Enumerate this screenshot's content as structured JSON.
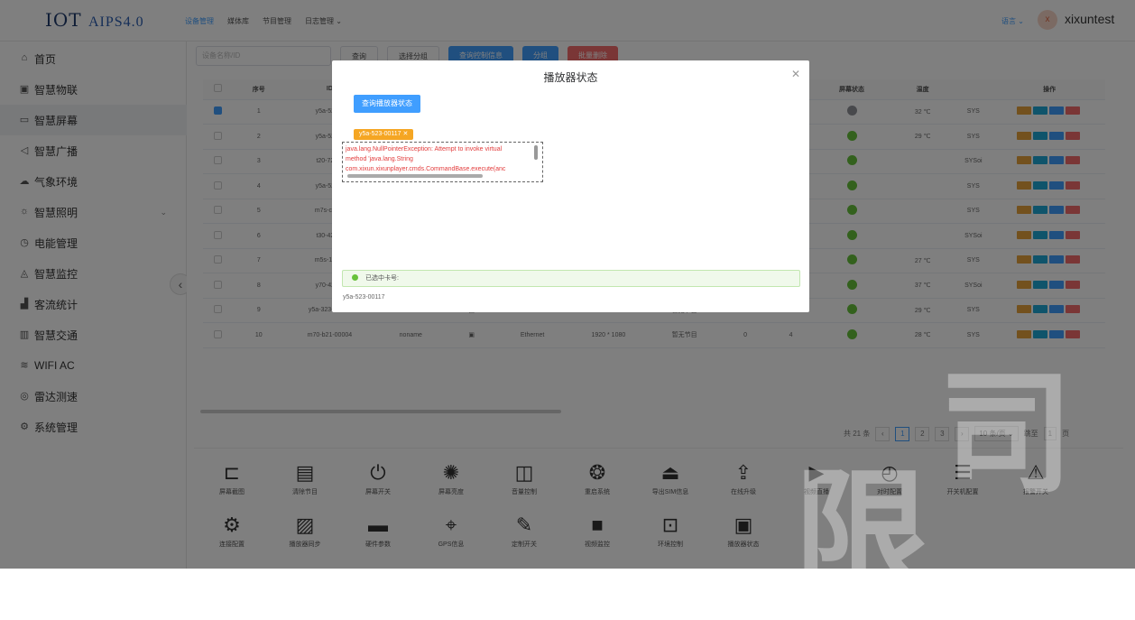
{
  "brand": {
    "name": "IOT",
    "version": "AIPS4.0"
  },
  "topnav": [
    "设备管理",
    "媒体库",
    "节目管理",
    "日志管理 ⌄"
  ],
  "lang": "语言 ⌄",
  "user": {
    "avatar": "x",
    "name": "xixuntest"
  },
  "sidebar": {
    "items": [
      {
        "label": "首页",
        "icon": "home-icon"
      },
      {
        "label": "智慧物联",
        "icon": "iot-icon"
      },
      {
        "label": "智慧屏幕",
        "icon": "screen-icon"
      },
      {
        "label": "智慧广播",
        "icon": "speaker-icon"
      },
      {
        "label": "气象环境",
        "icon": "cloud-icon"
      },
      {
        "label": "智慧照明",
        "icon": "light-icon"
      },
      {
        "label": "电能管理",
        "icon": "power-icon"
      },
      {
        "label": "智慧监控",
        "icon": "camera-icon"
      },
      {
        "label": "客流统计",
        "icon": "stats-icon"
      },
      {
        "label": "智慧交通",
        "icon": "traffic-icon"
      },
      {
        "label": "WIFI AC",
        "icon": "wifi-icon"
      },
      {
        "label": "雷达测速",
        "icon": "radar-icon"
      },
      {
        "label": "系统管理",
        "icon": "gear-icon"
      }
    ]
  },
  "toolbar": {
    "search_placeholder": "设备名称/ID",
    "query": "查询",
    "group_select": "选择分组",
    "query_controller": "查询控制信息",
    "group": "分组",
    "batch_delete": "批量删除"
  },
  "table": {
    "headers": [
      "序号",
      "ID",
      "屏幕状态",
      "温度",
      "操作"
    ],
    "rows": [
      {
        "no": "1",
        "id": "y5a-523-0",
        "name": "",
        "net": "",
        "res": "",
        "prog": "",
        "bright": "",
        "vol": "",
        "on": false,
        "temp": "32 ℃",
        "sys": "SYS"
      },
      {
        "no": "2",
        "id": "y5a-523-0",
        "name": "",
        "net": "",
        "res": "",
        "prog": "",
        "bright": "",
        "vol": "",
        "on": true,
        "temp": "29 ℃",
        "sys": "SYS"
      },
      {
        "no": "3",
        "id": "t20-721-2",
        "name": "",
        "net": "",
        "res": "",
        "prog": "",
        "bright": "",
        "vol": "",
        "on": true,
        "temp": "",
        "sys": "SYSoi"
      },
      {
        "no": "4",
        "id": "y5a-523-0",
        "name": "",
        "net": "",
        "res": "",
        "prog": "",
        "bright": "",
        "vol": "",
        "on": true,
        "temp": "",
        "sys": "SYS"
      },
      {
        "no": "5",
        "id": "m7s-c22-0",
        "name": "",
        "net": "",
        "res": "",
        "prog": "",
        "bright": "",
        "vol": "",
        "on": true,
        "temp": "",
        "sys": "SYS"
      },
      {
        "no": "6",
        "id": "t30-423-0",
        "name": "",
        "net": "",
        "res": "",
        "prog": "",
        "bright": "",
        "vol": "",
        "on": true,
        "temp": "",
        "sys": "SYSoi"
      },
      {
        "no": "7",
        "id": "m5s-123-0",
        "name": "",
        "net": "",
        "res": "",
        "prog": "",
        "bright": "",
        "vol": "",
        "on": true,
        "temp": "27 ℃",
        "sys": "SYS"
      },
      {
        "no": "8",
        "id": "y70-421-0",
        "name": "",
        "net": "",
        "res": "",
        "prog": "",
        "bright": "",
        "vol": "",
        "on": true,
        "temp": "37 ℃",
        "sys": "SYSoi"
      },
      {
        "no": "9",
        "id": "y5a-323-00013",
        "name": "noname",
        "net": "Ethernet",
        "res": "1280 * 720",
        "prog": "暂无节目",
        "bright": "100%",
        "vol": "12",
        "on": true,
        "temp": "29 ℃",
        "sys": "SYS"
      },
      {
        "no": "10",
        "id": "m70-b21-00004",
        "name": "noname",
        "net": "Ethernet",
        "res": "1920 * 1080",
        "prog": "暂无节目",
        "bright": "0",
        "vol": "4",
        "on": true,
        "temp": "28 ℃",
        "sys": "SYS"
      }
    ]
  },
  "pager": {
    "total": "共 21 条",
    "pages": [
      "1",
      "2",
      "3"
    ],
    "size": "10 条/页 ⌄",
    "goto": "跳至",
    "goto_val": "1",
    "page_suffix": "页"
  },
  "functions": [
    {
      "label": "屏幕截图",
      "glyph": "⊏"
    },
    {
      "label": "清除节目",
      "glyph": "▤"
    },
    {
      "label": "屏幕开关",
      "glyph": "⏻"
    },
    {
      "label": "屏幕亮度",
      "glyph": "✺"
    },
    {
      "label": "音量控制",
      "glyph": "◫"
    },
    {
      "label": "重启系统",
      "glyph": "❂"
    },
    {
      "label": "导出SIM信息",
      "glyph": "⏏"
    },
    {
      "label": "在线升级",
      "glyph": "⇪"
    },
    {
      "label": "视频直播",
      "glyph": "▶"
    },
    {
      "label": "对时配置",
      "glyph": "◴"
    },
    {
      "label": "开关机配置",
      "glyph": "☰"
    },
    {
      "label": "报警开关",
      "glyph": "⚠"
    },
    {
      "label": "连接配置",
      "glyph": "⚙"
    },
    {
      "label": "播放器同步",
      "glyph": "▨"
    },
    {
      "label": "硬件参数",
      "glyph": "▬"
    },
    {
      "label": "GPS信息",
      "glyph": "⌖"
    },
    {
      "label": "定制开关",
      "glyph": "✎"
    },
    {
      "label": "视频监控",
      "glyph": "■"
    },
    {
      "label": "环境控制",
      "glyph": "⊡"
    },
    {
      "label": "播放器状态",
      "glyph": "▣"
    }
  ],
  "modal": {
    "title": "播放器状态",
    "query_button": "查询播放器状态",
    "tag": "y5a-523-00117",
    "error_lines": [
      "java.lang.NullPointerException: Attempt to invoke virtual",
      "method 'java.lang.String",
      "com.xixun.xixunplayer.cmds.CommandBase.execute(anc"
    ],
    "selected_label": "已选中卡号:",
    "selected_card": "y5a-523-00117"
  }
}
